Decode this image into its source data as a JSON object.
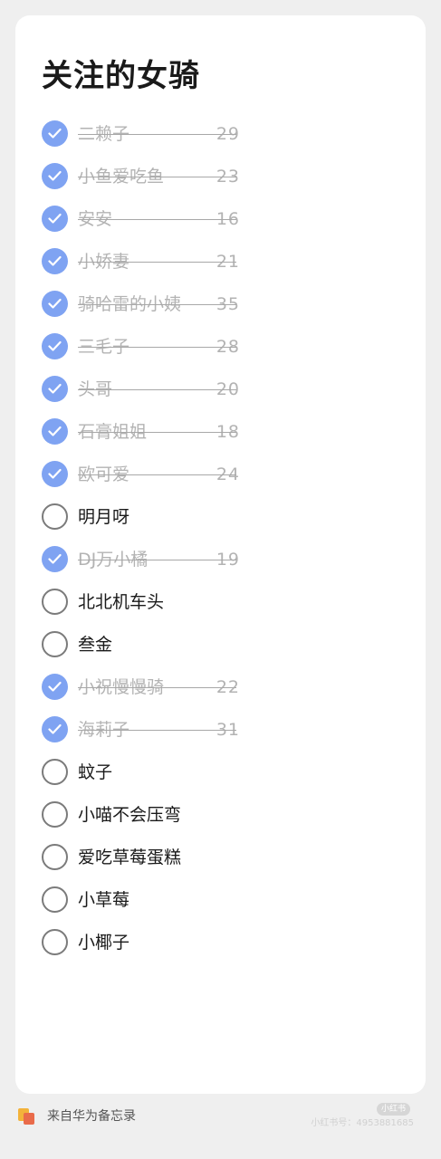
{
  "note": {
    "title": "关注的女骑",
    "items": [
      {
        "name": "二赖子",
        "number": "29",
        "done": true
      },
      {
        "name": "小鱼爱吃鱼",
        "number": "23",
        "done": true
      },
      {
        "name": "安安",
        "number": "16",
        "done": true
      },
      {
        "name": "小娇妻",
        "number": "21",
        "done": true
      },
      {
        "name": "骑哈雷的小姨",
        "number": "35",
        "done": true
      },
      {
        "name": "三毛子",
        "number": "28",
        "done": true
      },
      {
        "name": "头哥",
        "number": "20",
        "done": true
      },
      {
        "name": "石膏姐姐",
        "number": "18",
        "done": true
      },
      {
        "name": "欧可爱",
        "number": "24",
        "done": true
      },
      {
        "name": "明月呀",
        "number": "",
        "done": false
      },
      {
        "name": "DJ万小橘",
        "number": "19",
        "done": true
      },
      {
        "name": "北北机车头",
        "number": "",
        "done": false
      },
      {
        "name": "叁金",
        "number": "",
        "done": false
      },
      {
        "name": "小祝慢慢骑",
        "number": "22",
        "done": true
      },
      {
        "name": "海莉子",
        "number": "31",
        "done": true
      },
      {
        "name": "蚊子",
        "number": "",
        "done": false
      },
      {
        "name": "小喵不会压弯",
        "number": "",
        "done": false
      },
      {
        "name": "爱吃草莓蛋糕",
        "number": "",
        "done": false
      },
      {
        "name": "小草莓",
        "number": "",
        "done": false
      },
      {
        "name": "小椰子",
        "number": "",
        "done": false
      }
    ]
  },
  "footer": {
    "source_text": "来自华为备忘录",
    "app_icon": "notepad-icon",
    "watermark_badge": "小红书",
    "watermark_text": "小红书号：4953881685"
  },
  "colors": {
    "checked_fill": "#7fa3f2",
    "unchecked_border": "#7b7b7b",
    "done_text": "#b3b3b3",
    "text": "#1a1a1a"
  }
}
